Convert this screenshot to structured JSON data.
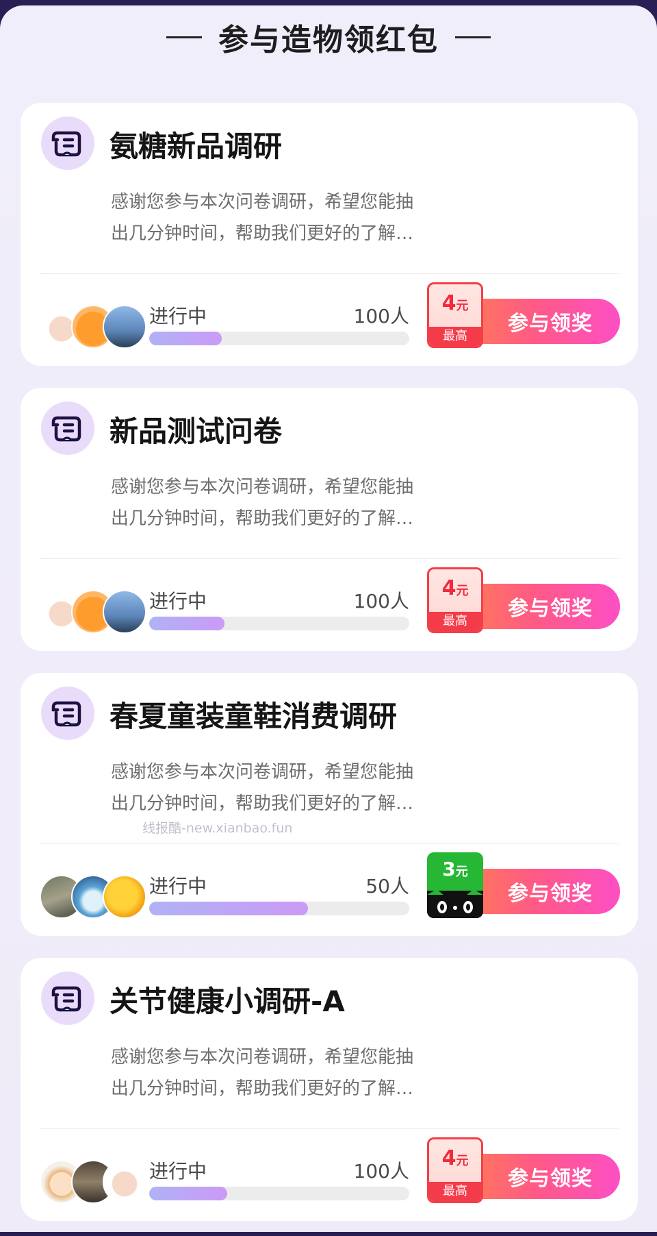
{
  "header": {
    "title": "参与造物领红包"
  },
  "surveys": [
    {
      "title": "氨糖新品调研",
      "desc_line1": "感谢您参与本次问卷调研，希望您能抽",
      "desc_line2": "出几分钟时间，帮助我们更好的了解…",
      "status": "进行中",
      "count": "100人",
      "progress": 0.28,
      "badge_amount": "4",
      "badge_unit": "元",
      "badge_sub": "最高",
      "cta": "参与领奖"
    },
    {
      "title": "新品测试问卷",
      "desc_line1": "感谢您参与本次问卷调研，希望您能抽",
      "desc_line2": "出几分钟时间，帮助我们更好的了解…",
      "status": "进行中",
      "count": "100人",
      "progress": 0.29,
      "badge_amount": "4",
      "badge_unit": "元",
      "badge_sub": "最高",
      "cta": "参与领奖"
    },
    {
      "title": "春夏童装童鞋消费调研",
      "desc_line1": "感谢您参与本次问卷调研，希望您能抽",
      "desc_line2": "出几分钟时间，帮助我们更好的了解…",
      "status": "进行中",
      "count": "50人",
      "progress": 0.61,
      "badge_amount": "3",
      "badge_unit": "元",
      "cta": "参与领奖"
    },
    {
      "title": "关节健康小调研-A",
      "desc_line1": "感谢您参与本次问卷调研，希望您能抽",
      "desc_line2": "出几分钟时间，帮助我们更好的了解…",
      "status": "进行中",
      "count": "100人",
      "progress": 0.3,
      "badge_amount": "4",
      "badge_unit": "元",
      "badge_sub": "最高",
      "cta": "参与领奖"
    }
  ],
  "watermark": "线报酷-new.xianbao.fun",
  "colors": {
    "accent_gradient_start": "#ff8a3c",
    "accent_gradient_end": "#fd4fc4",
    "badge_red": "#f33f4a",
    "badge_green": "#26b734",
    "progress_fill": "#c09ff7"
  },
  "icons": {
    "survey": "scroll-icon",
    "tmall": "tmall-cat-icon"
  }
}
